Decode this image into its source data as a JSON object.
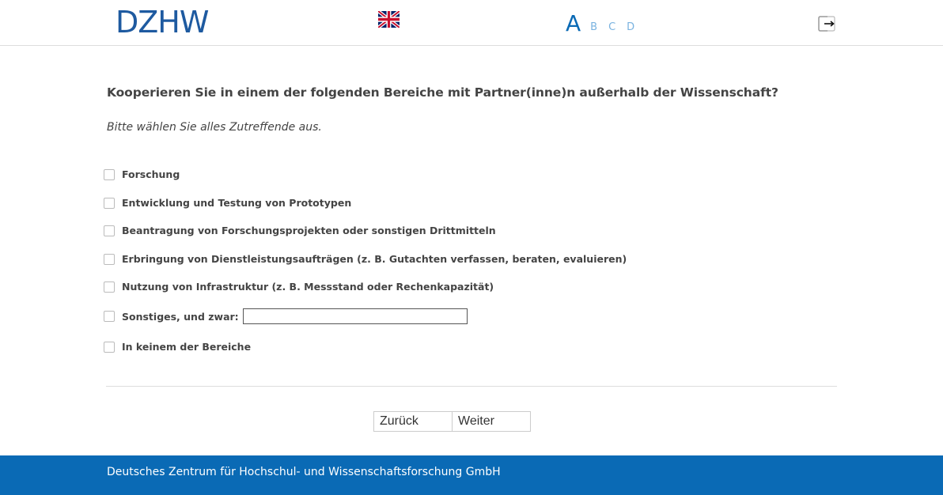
{
  "header": {
    "logo_text": "DZHW",
    "language_flag_icon": "uk-flag-icon",
    "font_sizes": [
      "A",
      "B",
      "C",
      "D"
    ],
    "logout_icon": "logout-icon"
  },
  "question": {
    "title": "Kooperieren Sie in einem der folgenden Bereiche mit Partner(inne)n außerhalb der Wissenschaft?",
    "instruction": "Bitte wählen Sie alles Zutreffende aus."
  },
  "options": [
    {
      "label": "Forschung",
      "checked": false
    },
    {
      "label": "Entwicklung und Testung von Prototypen",
      "checked": false
    },
    {
      "label": "Beantragung von Forschungsprojekten oder sonstigen Drittmitteln",
      "checked": false
    },
    {
      "label": "Erbringung von Dienstleistungsaufträgen (z.  B. Gutachten verfassen, beraten, evaluieren)",
      "checked": false
    },
    {
      "label": "Nutzung von Infrastruktur (z.  B. Messstand oder Rechenkapazität)",
      "checked": false
    },
    {
      "label": "Sonstiges, und zwar:",
      "checked": false,
      "input_value": ""
    },
    {
      "label": "In keinem der Bereiche",
      "checked": false
    }
  ],
  "navigation": {
    "back_label": "Zurück",
    "next_label": "Weiter"
  },
  "footer": {
    "text": "Deutsches Zentrum für Hochschul- und Wissenschaftsforschung GmbH"
  },
  "colors": {
    "brand_blue": "#0a6ab5",
    "logo_blue": "#1e5aa0",
    "inactive_font_size": "#7ab3e0"
  }
}
